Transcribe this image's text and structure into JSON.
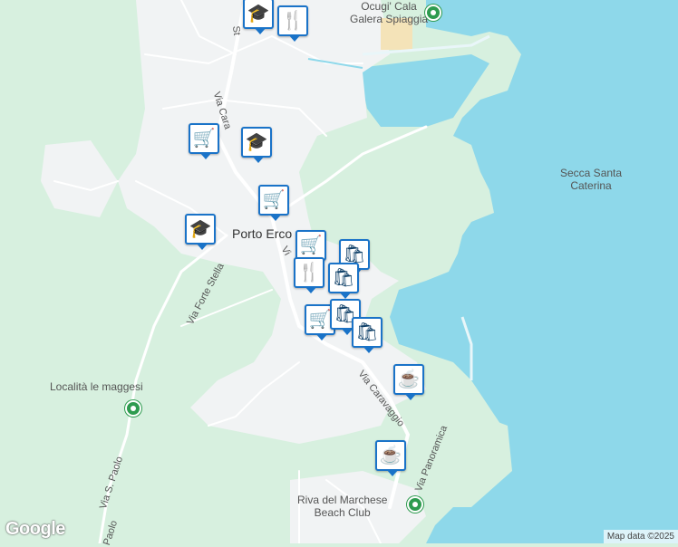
{
  "map": {
    "places": {
      "porto_ercole": "Porto Erco",
      "ocugi": "Ocugi' Cala\nGalera Spiaggia",
      "secca": "Secca Santa\nCaterina",
      "maggesi": "Località le maggesi",
      "riva": "Riva del Marchese\nBeach Club"
    },
    "streets": {
      "via_cara": "Via Cara",
      "via_forte_stella": "Via Forte Stella",
      "via_caravaggio": "Via Caravaggio",
      "via_panoramica": "Via Panoramica",
      "via_s_paolo": "Via S. Paolo",
      "paolo": "Paolo",
      "st": "St",
      "vi": "Vi"
    },
    "colors": {
      "land": "#d7f0df",
      "urban": "#f1f3f4",
      "water": "#8ed8ea",
      "road": "#ffffff",
      "marker_border": "#1a73c8",
      "poi_green": "#2e9b4f"
    },
    "markers": [
      {
        "icon": "graduation-cap-icon",
        "glyph": "🎓"
      },
      {
        "icon": "fork-knife-icon",
        "glyph": "🍴"
      },
      {
        "icon": "shopping-cart-icon",
        "glyph": "🛒"
      },
      {
        "icon": "graduation-cap-icon",
        "glyph": "🎓"
      },
      {
        "icon": "shopping-cart-icon",
        "glyph": "🛒"
      },
      {
        "icon": "graduation-cap-icon",
        "glyph": "🎓"
      },
      {
        "icon": "shopping-cart-icon",
        "glyph": "🛒"
      },
      {
        "icon": "shopping-bag-icon",
        "glyph": "🛍"
      },
      {
        "icon": "fork-knife-icon",
        "glyph": "🍴"
      },
      {
        "icon": "shopping-bag-icon",
        "glyph": "🛍"
      },
      {
        "icon": "shopping-cart-icon",
        "glyph": "🛒"
      },
      {
        "icon": "shopping-bag-icon",
        "glyph": "🛍"
      },
      {
        "icon": "shopping-bag-icon",
        "glyph": "🛍"
      },
      {
        "icon": "coffee-cup-icon",
        "glyph": "☕"
      },
      {
        "icon": "coffee-cup-icon",
        "glyph": "☕"
      }
    ]
  },
  "footer": {
    "logo": "Google",
    "attribution": "Map data ©2025"
  }
}
